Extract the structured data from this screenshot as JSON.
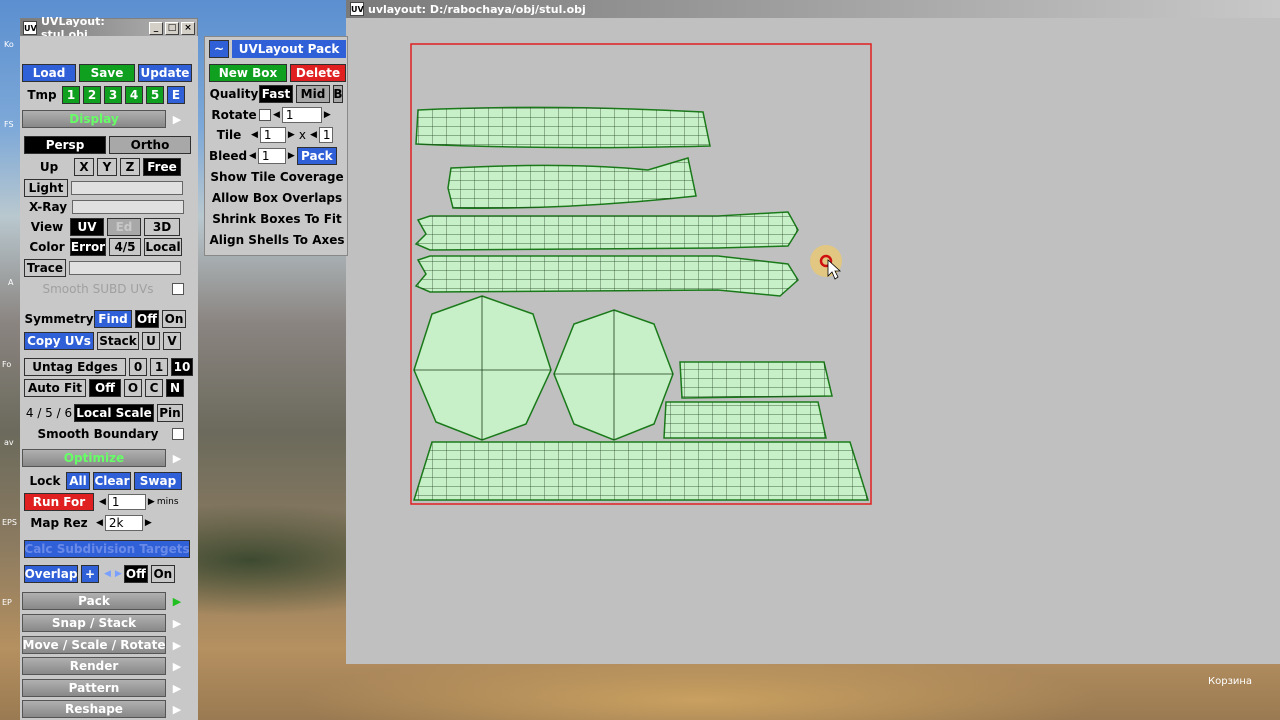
{
  "desktop": {
    "icon_labels": [
      "Ko",
      "FS",
      "A",
      "Fo",
      "av",
      "EPS",
      "EP"
    ],
    "recycle_label": "Корзина"
  },
  "main_window": {
    "title": "uvlayout: D:/rabochaya/obj/stul.obj",
    "app_icon": "UV"
  },
  "panel_window": {
    "title": "UVLayout: stul.obj",
    "app_icon": "UV",
    "controls": [
      "_",
      "□",
      "×"
    ]
  },
  "panel": {
    "load": "Load",
    "save": "Save",
    "update": "Update",
    "tmp_label": "Tmp",
    "tmp_slots": [
      "1",
      "2",
      "3",
      "4",
      "5",
      "E"
    ],
    "display_section": "Display",
    "persp": "Persp",
    "ortho": "Ortho",
    "up_label": "Up",
    "up_options": [
      "X",
      "Y",
      "Z",
      "Free"
    ],
    "light": "Light",
    "xray": "X-Ray",
    "view_label": "View",
    "view_options": [
      "UV",
      "Ed",
      "3D"
    ],
    "color_label": "Color",
    "color_options": [
      "Error",
      "4/5",
      "Local"
    ],
    "trace": "Trace",
    "smooth_subd": "Smooth SUBD UVs",
    "symmetry": "Symmetry",
    "find": "Find",
    "sym_off": "Off",
    "sym_on": "On",
    "copy_uvs": "Copy UVs",
    "stack": "Stack",
    "u": "U",
    "v": "V",
    "untag_edges": "Untag Edges",
    "untag_options": [
      "0",
      "1",
      "10"
    ],
    "auto_fit": "Auto Fit",
    "auto_fit_options": [
      "Off",
      "O",
      "C",
      "N"
    ],
    "keys_456": "4 / 5 / 6",
    "local_scale": "Local Scale",
    "pin": "Pin",
    "smooth_boundary": "Smooth Boundary",
    "optimize_section": "Optimize",
    "lock": "Lock",
    "lock_all": "All",
    "lock_clear": "Clear",
    "lock_swap": "Swap",
    "run_for": "Run For",
    "run_for_value": "1",
    "mins": "mins",
    "map_rez": "Map Rez",
    "map_rez_value": "2k",
    "calc_subd": "Calc Subdivision Targets",
    "overlap": "Overlap",
    "overlap_plus": "+",
    "overlap_off": "Off",
    "overlap_on": "On",
    "sections": [
      "Pack",
      "Snap / Stack",
      "Move / Scale / Rotate",
      "Render",
      "Pattern",
      "Reshape"
    ]
  },
  "pack_window": {
    "tilde": "~",
    "title": "UVLayout Pack",
    "new_box": "New Box",
    "delete": "Delete",
    "quality_label": "Quality",
    "quality_options": [
      "Fast",
      "Mid",
      "B"
    ],
    "rotate_label": "Rotate",
    "rotate_value": "1",
    "tile_label": "Tile",
    "tile_x": "1",
    "tile_sep": "x",
    "tile_y": "1",
    "bleed_label": "Bleed",
    "bleed_value": "1",
    "pack": "Pack",
    "options": [
      "Show Tile Coverage",
      "Allow Box Overlaps",
      "Shrink Boxes To Fit",
      "Align Shells To Axes"
    ]
  },
  "colors": {
    "shell_fill": "#c8f0c8",
    "shell_stroke": "#1a7a1a",
    "tile_border": "#e02020"
  }
}
